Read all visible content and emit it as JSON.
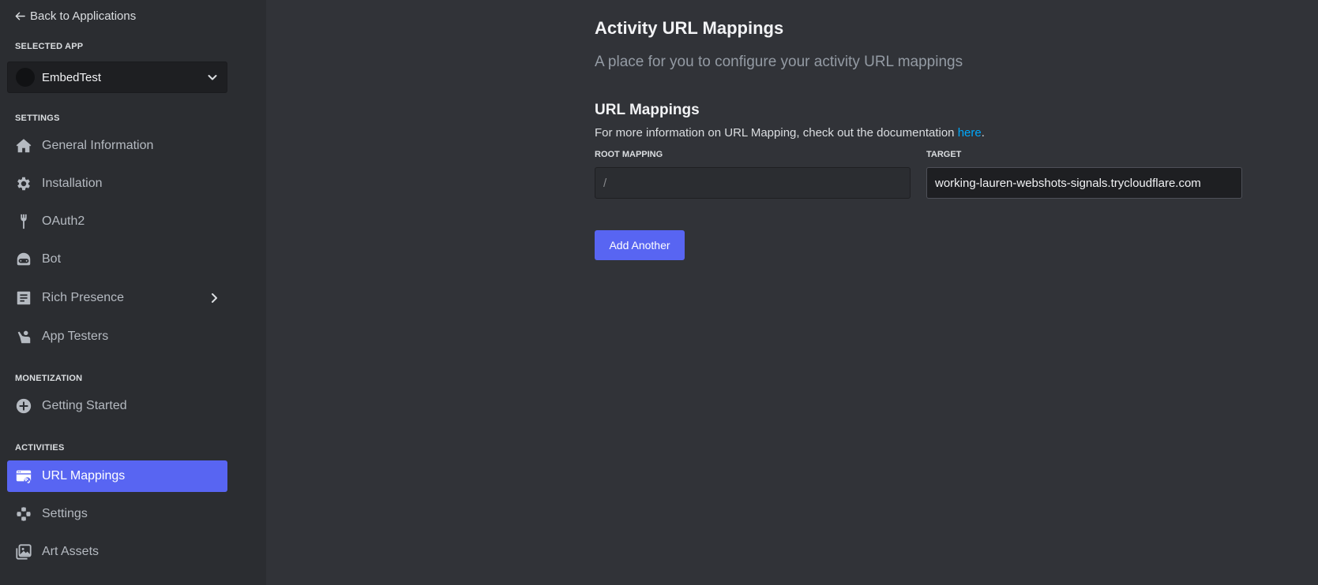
{
  "sidebar": {
    "back_label": "Back to Applications",
    "selected_app_heading": "SELECTED APP",
    "selected_app_name": "EmbedTest",
    "settings_heading": "SETTINGS",
    "settings_items": [
      {
        "label": "General Information",
        "icon": "home-icon"
      },
      {
        "label": "Installation",
        "icon": "gear-icon"
      },
      {
        "label": "OAuth2",
        "icon": "wrench-icon"
      },
      {
        "label": "Bot",
        "icon": "robot-icon"
      },
      {
        "label": "Rich Presence",
        "icon": "document-icon"
      },
      {
        "label": "App Testers",
        "icon": "user-wave-icon"
      }
    ],
    "monetization_heading": "MONETIZATION",
    "monetization_items": [
      {
        "label": "Getting Started",
        "icon": "plus-circle-icon"
      }
    ],
    "activities_heading": "ACTIVITIES",
    "activities_items": [
      {
        "label": "URL Mappings",
        "icon": "browser-link-icon",
        "active": true
      },
      {
        "label": "Settings",
        "icon": "gamepad-icon"
      },
      {
        "label": "Art Assets",
        "icon": "image-icon"
      }
    ]
  },
  "main": {
    "title": "Activity URL Mappings",
    "subtitle": "A place for you to configure your activity URL mappings",
    "section_title": "URL Mappings",
    "section_desc_prefix": "For more information on URL Mapping, check out the documentation ",
    "section_desc_link": "here",
    "section_desc_suffix": ".",
    "root_mapping_label": "ROOT MAPPING",
    "root_mapping_placeholder": "/",
    "target_label": "TARGET",
    "target_value": "working-lauren-webshots-signals.trycloudflare.com",
    "add_button_label": "Add Another"
  },
  "colors": {
    "accent": "#5865f2",
    "link": "#00a8fc",
    "sidebar_bg": "#2b2d31",
    "main_bg": "#313338"
  }
}
